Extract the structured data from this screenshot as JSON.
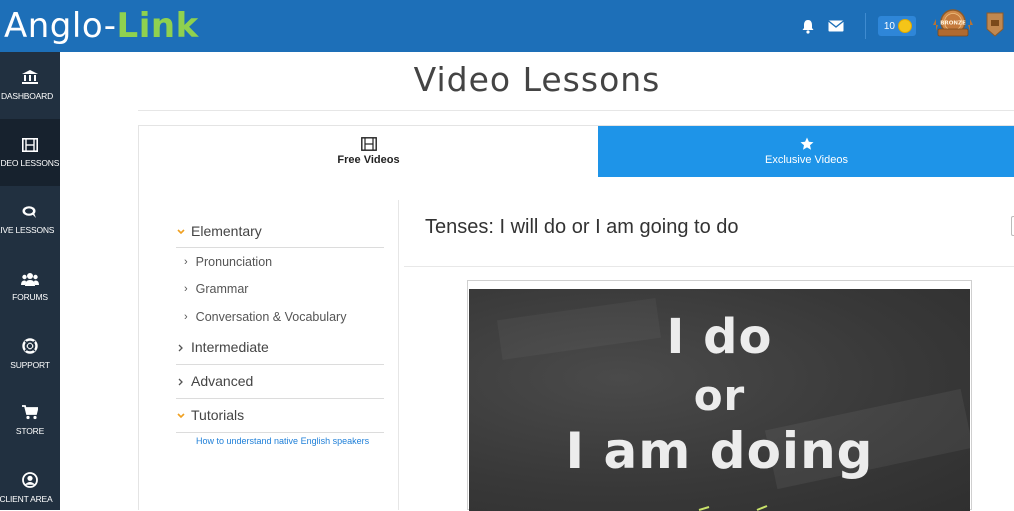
{
  "app": {
    "logo_part1": "Anglo-",
    "logo_part2": "Link",
    "coins_count": "10",
    "badge_label": "BRONZE"
  },
  "colors": {
    "topbar": "#1d6fb8",
    "sidebar": "#213040",
    "accent_green": "#8fd14f",
    "active_tab": "#1e94e8",
    "link": "#1e7fd8"
  },
  "sidebar": {
    "items": [
      {
        "label": "DASHBOARD",
        "icon": "bank-icon"
      },
      {
        "label": "VIDEO LESSONS",
        "icon": "film-icon",
        "active": true
      },
      {
        "label": "LIVE LESSONS",
        "icon": "chat-icon"
      },
      {
        "label": "FORUMS",
        "icon": "users-icon"
      },
      {
        "label": "SUPPORT",
        "icon": "lifebuoy-icon"
      },
      {
        "label": "STORE",
        "icon": "cart-icon"
      },
      {
        "label": "CLIENT AREA",
        "icon": "user-circle-icon"
      }
    ]
  },
  "page": {
    "title": "Video Lessons"
  },
  "tabs": [
    {
      "label": "Free Videos",
      "icon": "film-icon",
      "active": true
    },
    {
      "label": "Exclusive Videos",
      "icon": "star-icon",
      "active": false
    }
  ],
  "menu": {
    "categories": [
      {
        "label": "Elementary",
        "expanded": true,
        "subitems": [
          "Pronunciation",
          "Grammar",
          "Conversation & Vocabulary"
        ]
      },
      {
        "label": "Intermediate",
        "expanded": false
      },
      {
        "label": "Advanced",
        "expanded": false
      },
      {
        "label": "Tutorials",
        "expanded": true,
        "links": [
          "How to understand native English speakers"
        ]
      }
    ]
  },
  "lesson": {
    "title": "Tenses: I will do or I am going to do",
    "thumbnail_lines": [
      "I do",
      "or",
      "I am doing"
    ]
  }
}
